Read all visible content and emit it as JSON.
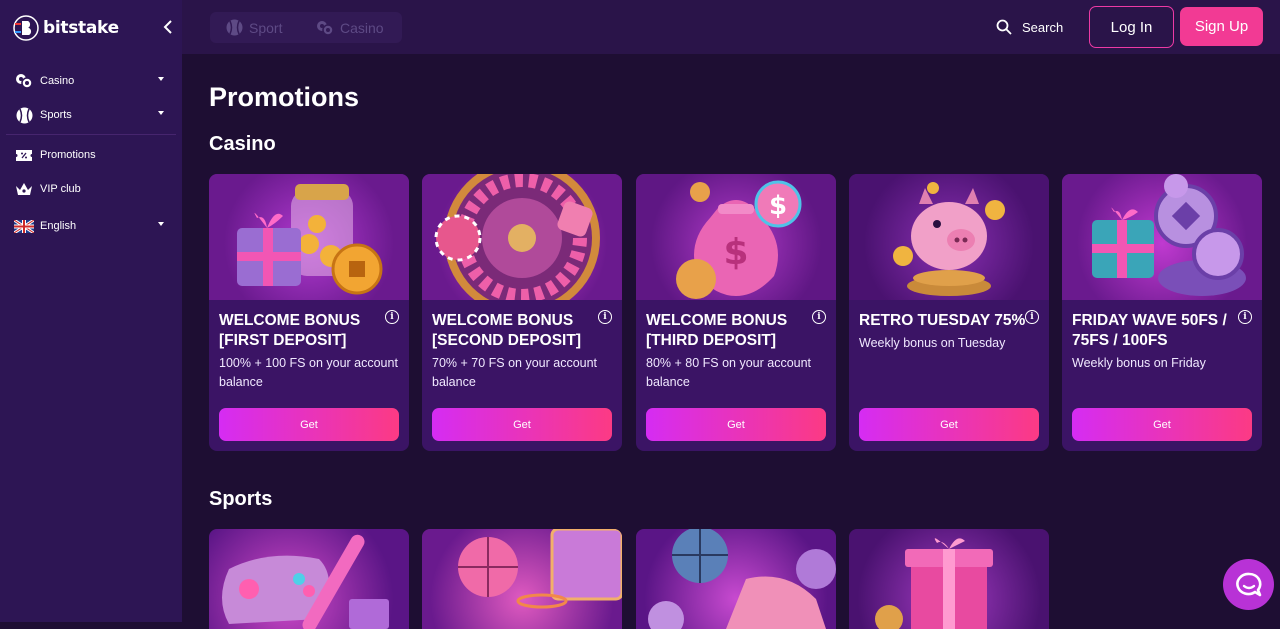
{
  "brand": {
    "name": "bitstake"
  },
  "sidebar": {
    "items": [
      {
        "label": "Casino",
        "icon": "casino-chips-icon",
        "has_caret": true
      },
      {
        "label": "Sports",
        "icon": "baseball-icon",
        "has_caret": true
      },
      {
        "label": "Promotions",
        "icon": "ticket-percent-icon",
        "has_caret": false
      },
      {
        "label": "VIP club",
        "icon": "crown-icon",
        "has_caret": false
      },
      {
        "label": "English",
        "icon": "uk-flag-icon",
        "has_caret": true
      }
    ]
  },
  "header": {
    "tabs": [
      {
        "label": "Sport",
        "icon": "baseball-icon"
      },
      {
        "label": "Casino",
        "icon": "casino-chips-icon"
      }
    ],
    "search_label": "Search",
    "login_label": "Log In",
    "signup_label": "Sign Up"
  },
  "page": {
    "title": "Promotions",
    "casino_heading": "Casino",
    "sports_heading": "Sports"
  },
  "casino_promos": [
    {
      "title": "WELCOME BONUS [FIRST DEPOSIT]",
      "desc": "100% + 100 FS on your account balance",
      "button": "Get",
      "art": "gift-coin-jar"
    },
    {
      "title": "WELCOME BONUS [SECOND DEPOSIT]",
      "desc": "70% + 70 FS on your account balance",
      "button": "Get",
      "art": "roulette-wheel"
    },
    {
      "title": "WELCOME BONUS [THIRD DEPOSIT]",
      "desc": "80% + 80 FS on your account balance",
      "button": "Get",
      "art": "money-bag"
    },
    {
      "title": "RETRO TUESDAY 75%",
      "desc": "Weekly bonus on Tuesday",
      "button": "Get",
      "art": "piggy-bank"
    },
    {
      "title": "FRIDAY WAVE 50FS / 75FS / 100FS",
      "desc": "Weekly bonus on Friday",
      "button": "Get",
      "art": "gift-coins"
    }
  ],
  "sports_promos": [
    {
      "art": "gamepad-bat"
    },
    {
      "art": "basketball-hoop"
    },
    {
      "art": "basketball-sneaker"
    },
    {
      "art": "gift-box"
    }
  ],
  "info_icon_glyph": "i",
  "colors": {
    "background": "#1e0e33",
    "sidebar": "#2d1554",
    "card": "#3b1465",
    "accent_pink": "#f23a94",
    "button_gradient_start": "#d52cf3",
    "button_gradient_end": "#fc3a84",
    "chat_button": "#b832d6"
  }
}
